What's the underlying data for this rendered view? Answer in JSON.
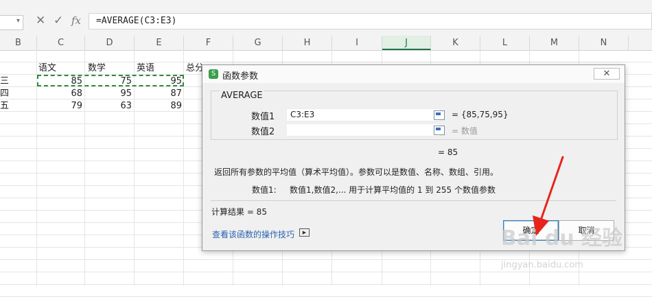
{
  "formula_bar": {
    "cancel_icon": "✕",
    "confirm_icon": "✓",
    "fx_label": "fx",
    "formula": "=AVERAGE(C3:E3)"
  },
  "columns": [
    {
      "label": "B",
      "selected": false
    },
    {
      "label": "C",
      "selected": false
    },
    {
      "label": "D",
      "selected": false
    },
    {
      "label": "E",
      "selected": false
    },
    {
      "label": "F",
      "selected": false
    },
    {
      "label": "G",
      "selected": false
    },
    {
      "label": "H",
      "selected": false
    },
    {
      "label": "I",
      "selected": false
    },
    {
      "label": "J",
      "selected": true
    },
    {
      "label": "K",
      "selected": false
    },
    {
      "label": "L",
      "selected": false
    },
    {
      "label": "M",
      "selected": false
    },
    {
      "label": "N",
      "selected": false
    }
  ],
  "sheet": {
    "headers": [
      "语文",
      "数学",
      "英语",
      "总分"
    ],
    "rows": [
      {
        "name": "三",
        "scores": [
          "85",
          "75",
          "95"
        ]
      },
      {
        "name": "四",
        "scores": [
          "68",
          "95",
          "87"
        ]
      },
      {
        "name": "五",
        "scores": [
          "79",
          "63",
          "89"
        ]
      }
    ]
  },
  "dialog": {
    "title": "函数参数",
    "close_icon": "✕",
    "function_name": "AVERAGE",
    "args": [
      {
        "label": "数值1",
        "value": "C3:E3",
        "result": "= {85,75,95}"
      },
      {
        "label": "数值2",
        "value": "",
        "result": "= 数值"
      }
    ],
    "result_line": "= 85",
    "description": "返回所有参数的平均值（算术平均值）。参数可以是数值、名称、数组、引用。",
    "arg_desc_label": "数值1:",
    "arg_desc_text": "数值1,数值2,... 用于计算平均值的 1 到 255 个数值参数",
    "calc_result": "计算结果 =  85",
    "tips_link": "查看该函数的操作技巧",
    "ok_label": "确定",
    "cancel_label": "取消"
  },
  "colors": {
    "accent_green": "#217346",
    "marquee_green": "#2e8b3d",
    "link_blue": "#2a62b0",
    "arrow_red": "#e8231c"
  },
  "watermark": {
    "brand": "Bai du 经验",
    "url": "jingyan.baidu.com"
  }
}
